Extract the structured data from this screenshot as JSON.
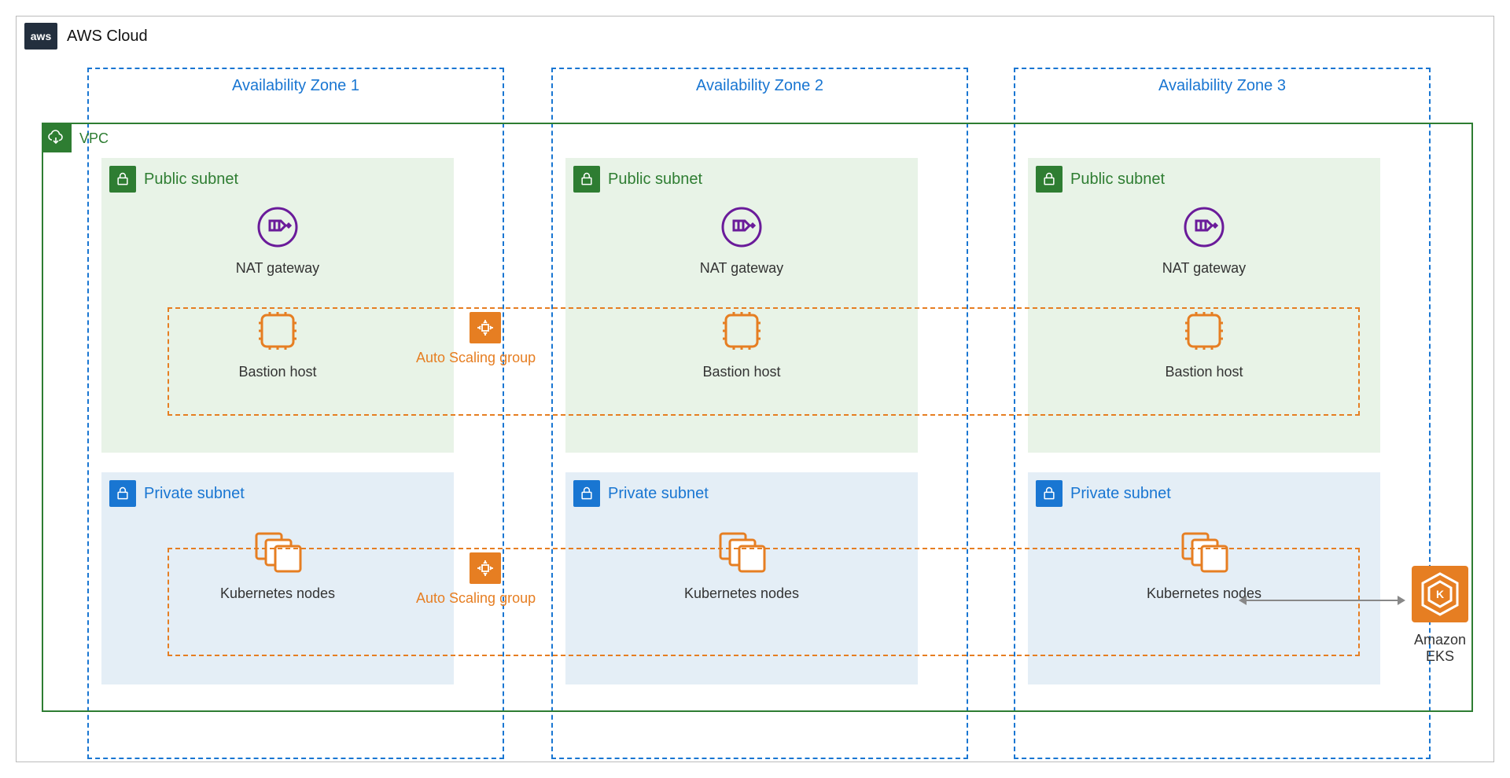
{
  "cloud_label": "AWS Cloud",
  "vpc_label": "VPC",
  "az": [
    {
      "label": "Availability Zone 1"
    },
    {
      "label": "Availability Zone 2"
    },
    {
      "label": "Availability Zone 3"
    }
  ],
  "public_subnet_label": "Public subnet",
  "private_subnet_label": "Private subnet",
  "nat_label": "NAT gateway",
  "bastion_label": "Bastion host",
  "k8s_label": "Kubernetes nodes",
  "asg_label": "Auto Scaling group",
  "eks_label": "Amazon EKS",
  "colors": {
    "vpc": "#2e7d32",
    "az": "#1976d2",
    "asg": "#e67e22",
    "aws": "#232f3e",
    "nat": "#6a1b9a"
  }
}
